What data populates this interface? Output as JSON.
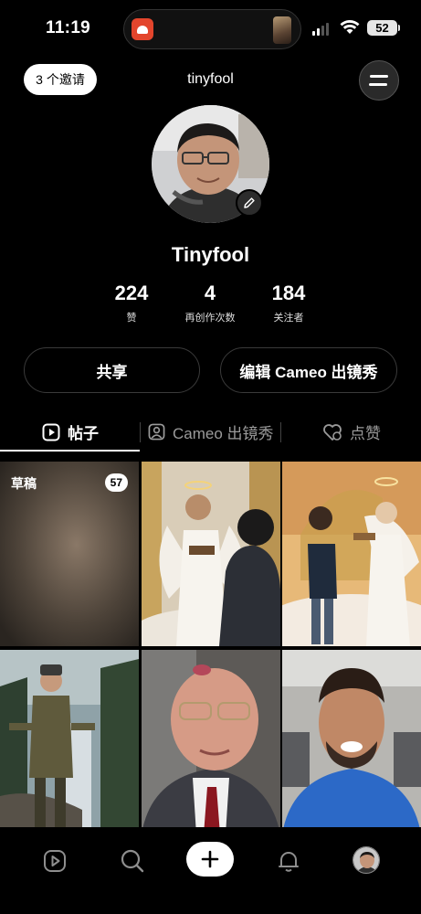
{
  "status_bar": {
    "time": "11:19",
    "battery": "52"
  },
  "header": {
    "invite_label": "3 个邀请",
    "username": "tinyfool"
  },
  "profile": {
    "display_name": "Tinyfool",
    "stats": [
      {
        "value": "224",
        "label": "赞"
      },
      {
        "value": "4",
        "label": "再创作次数"
      },
      {
        "value": "184",
        "label": "关注者"
      }
    ]
  },
  "actions": {
    "share_label": "共享",
    "edit_cameo_label": "编辑 Cameo 出镜秀"
  },
  "tabs": [
    {
      "label": "帖子",
      "icon": "play-square-icon",
      "active": true
    },
    {
      "label": "Cameo 出镜秀",
      "icon": "person-square-icon",
      "active": false
    },
    {
      "label": "点赞",
      "icon": "heart-icon",
      "active": false
    }
  ],
  "grid": {
    "draft_label": "草稿",
    "draft_count": "57",
    "items": [
      {
        "subject": "drafts-blurred"
      },
      {
        "subject": "angel-with-book"
      },
      {
        "subject": "man-and-angel-at-gates"
      },
      {
        "subject": "soldier-at-waterfall"
      },
      {
        "subject": "older-man-with-glasses"
      },
      {
        "subject": "man-in-blue-shirt-gym"
      }
    ]
  },
  "bottom_nav": {
    "items": [
      "feed-icon",
      "search-icon",
      "create-icon",
      "notifications-icon",
      "profile-avatar"
    ]
  },
  "colors": {
    "background": "#000000",
    "button_light": "#ffffff",
    "text_secondary": "#9a9a9a"
  }
}
